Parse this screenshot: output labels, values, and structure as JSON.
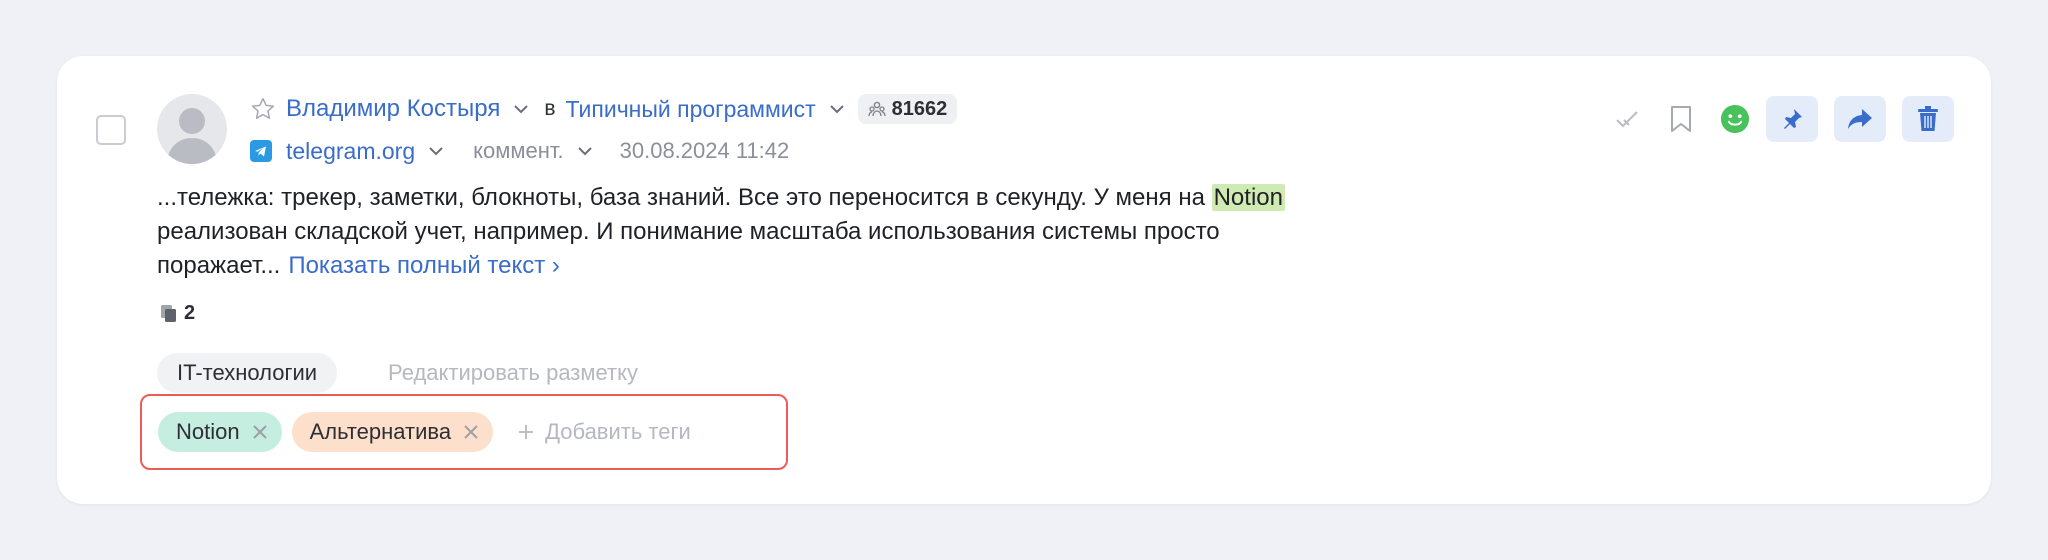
{
  "post": {
    "author": "Владимир Костыря",
    "in_word": "в",
    "channel": "Типичный программист",
    "subscribers": "81662",
    "source": "telegram.org",
    "type": "коммент.",
    "date": "30.08.2024 11:42",
    "text_before": "...тележка: трекер, заметки, блокноты, база знаний. Все это переносится в секунду. У меня на ",
    "highlight": "Notion",
    "text_after": " реализован складской учет, например. И понимание масштаба использования системы просто поражает...",
    "show_full": "Показать полный текст ›",
    "copies_count": "2",
    "category": "IT-технологии",
    "edit_markup": "Редактировать разметку",
    "tags": [
      {
        "label": "Notion",
        "color": "#c5ede0"
      },
      {
        "label": "Альтернатива",
        "color": "#fde0cc"
      }
    ],
    "add_tags": "Добавить теги"
  },
  "colors": {
    "link": "#3a6cc9",
    "highlight": "#cfeab3",
    "tags_border": "#ec5b56",
    "sentiment": "#48c25a",
    "action_bg": "#e4ecfa",
    "action_icon": "#3a6cc9"
  },
  "icons": {
    "select": "checkbox",
    "favorite": "star-icon",
    "source": "telegram-icon",
    "subscribers": "people-icon",
    "copies": "copies-icon",
    "actions": [
      "check-icon",
      "bookmark-icon",
      "smile-icon",
      "pin-icon",
      "share-icon",
      "trash-icon"
    ]
  }
}
